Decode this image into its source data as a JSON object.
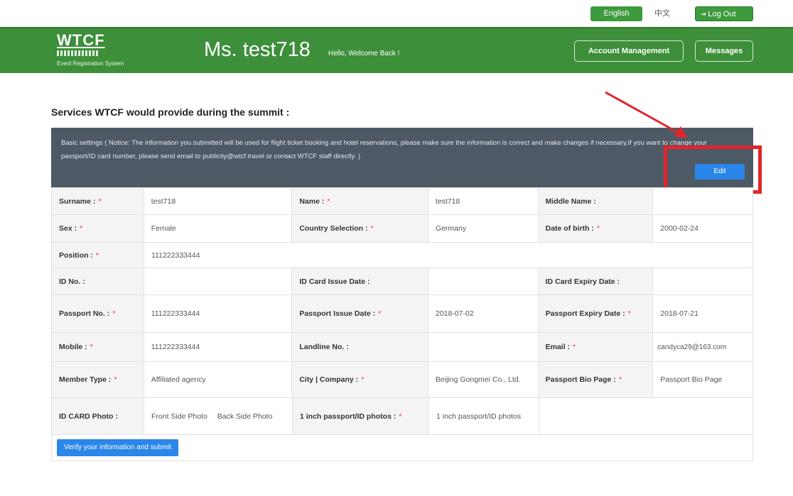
{
  "topbar": {
    "english_label": "English",
    "chinese_label": "中文",
    "logout_label": "Log Out"
  },
  "header": {
    "logo_mark": "WTCF",
    "logo_sub": "Event Registration System",
    "greeting": "Ms. test718",
    "welcome": "Hello, Welcome Back !",
    "account_btn": "Account Management",
    "messages_btn": "Messages"
  },
  "section_title": "Services WTCF would provide during the summit :",
  "notice": {
    "text": "Basic settings ( Notice: The information you submitted will be used for flight ticket booking and hotel reservations, please make sure the information is correct and make changes if necessary.If you want to change your passport/ID card number, please send email to publicity@wtcf.travel or contact WTCF staff directly. )",
    "edit_label": "Edit"
  },
  "required_mark": "*",
  "form": {
    "surname_label": "Surname :",
    "surname": "test718",
    "name_label": "Name :",
    "name": "test718",
    "middle_label": "Middle Name :",
    "middle": "",
    "sex_label": "Sex :",
    "sex": "Female",
    "country_label": "Country Selection :",
    "country": "Germany",
    "dob_label": "Date of birth :",
    "dob": "2000-02-24",
    "position_label": "Position :",
    "position": "111222333444",
    "id_label": "ID No. :",
    "id_issue_label": "ID Card Issue Date :",
    "id_expiry_label": "ID Card Expiry Date :",
    "passport_label": "Passport No. :",
    "passport": "111222333444",
    "passport_issue_label": "Passport Issue Date :",
    "passport_issue": "2018-07-02",
    "passport_expiry_label": "Passport Expiry Date :",
    "passport_expiry": "2018-07-21",
    "mobile_label": "Mobile :",
    "mobile": "111222333444",
    "landline_label": "Landline No. :",
    "email_label": "Email :",
    "email": "candyca29@163.com",
    "member_label": "Member Type :",
    "member": "Affiliated agency",
    "city_label": "City | Company :",
    "city": "Beijing Gongmei Co., Ltd.",
    "bio_label": "Passport Bio Page :",
    "bio": "Passport Bio Page",
    "idphoto_label": "ID CARD Photo :",
    "front_photo": "Front Side Photo",
    "back_photo": "Back Side Photo",
    "inch_label": "1 inch passport/ID photos :",
    "inch": "1 inch passport/ID photos"
  },
  "submit_label": "Verify your information and submit",
  "colors": {
    "header": "#3d8f3a",
    "notice": "#4e5966",
    "button": "#2a86e8",
    "highlight": "#e0262a"
  }
}
